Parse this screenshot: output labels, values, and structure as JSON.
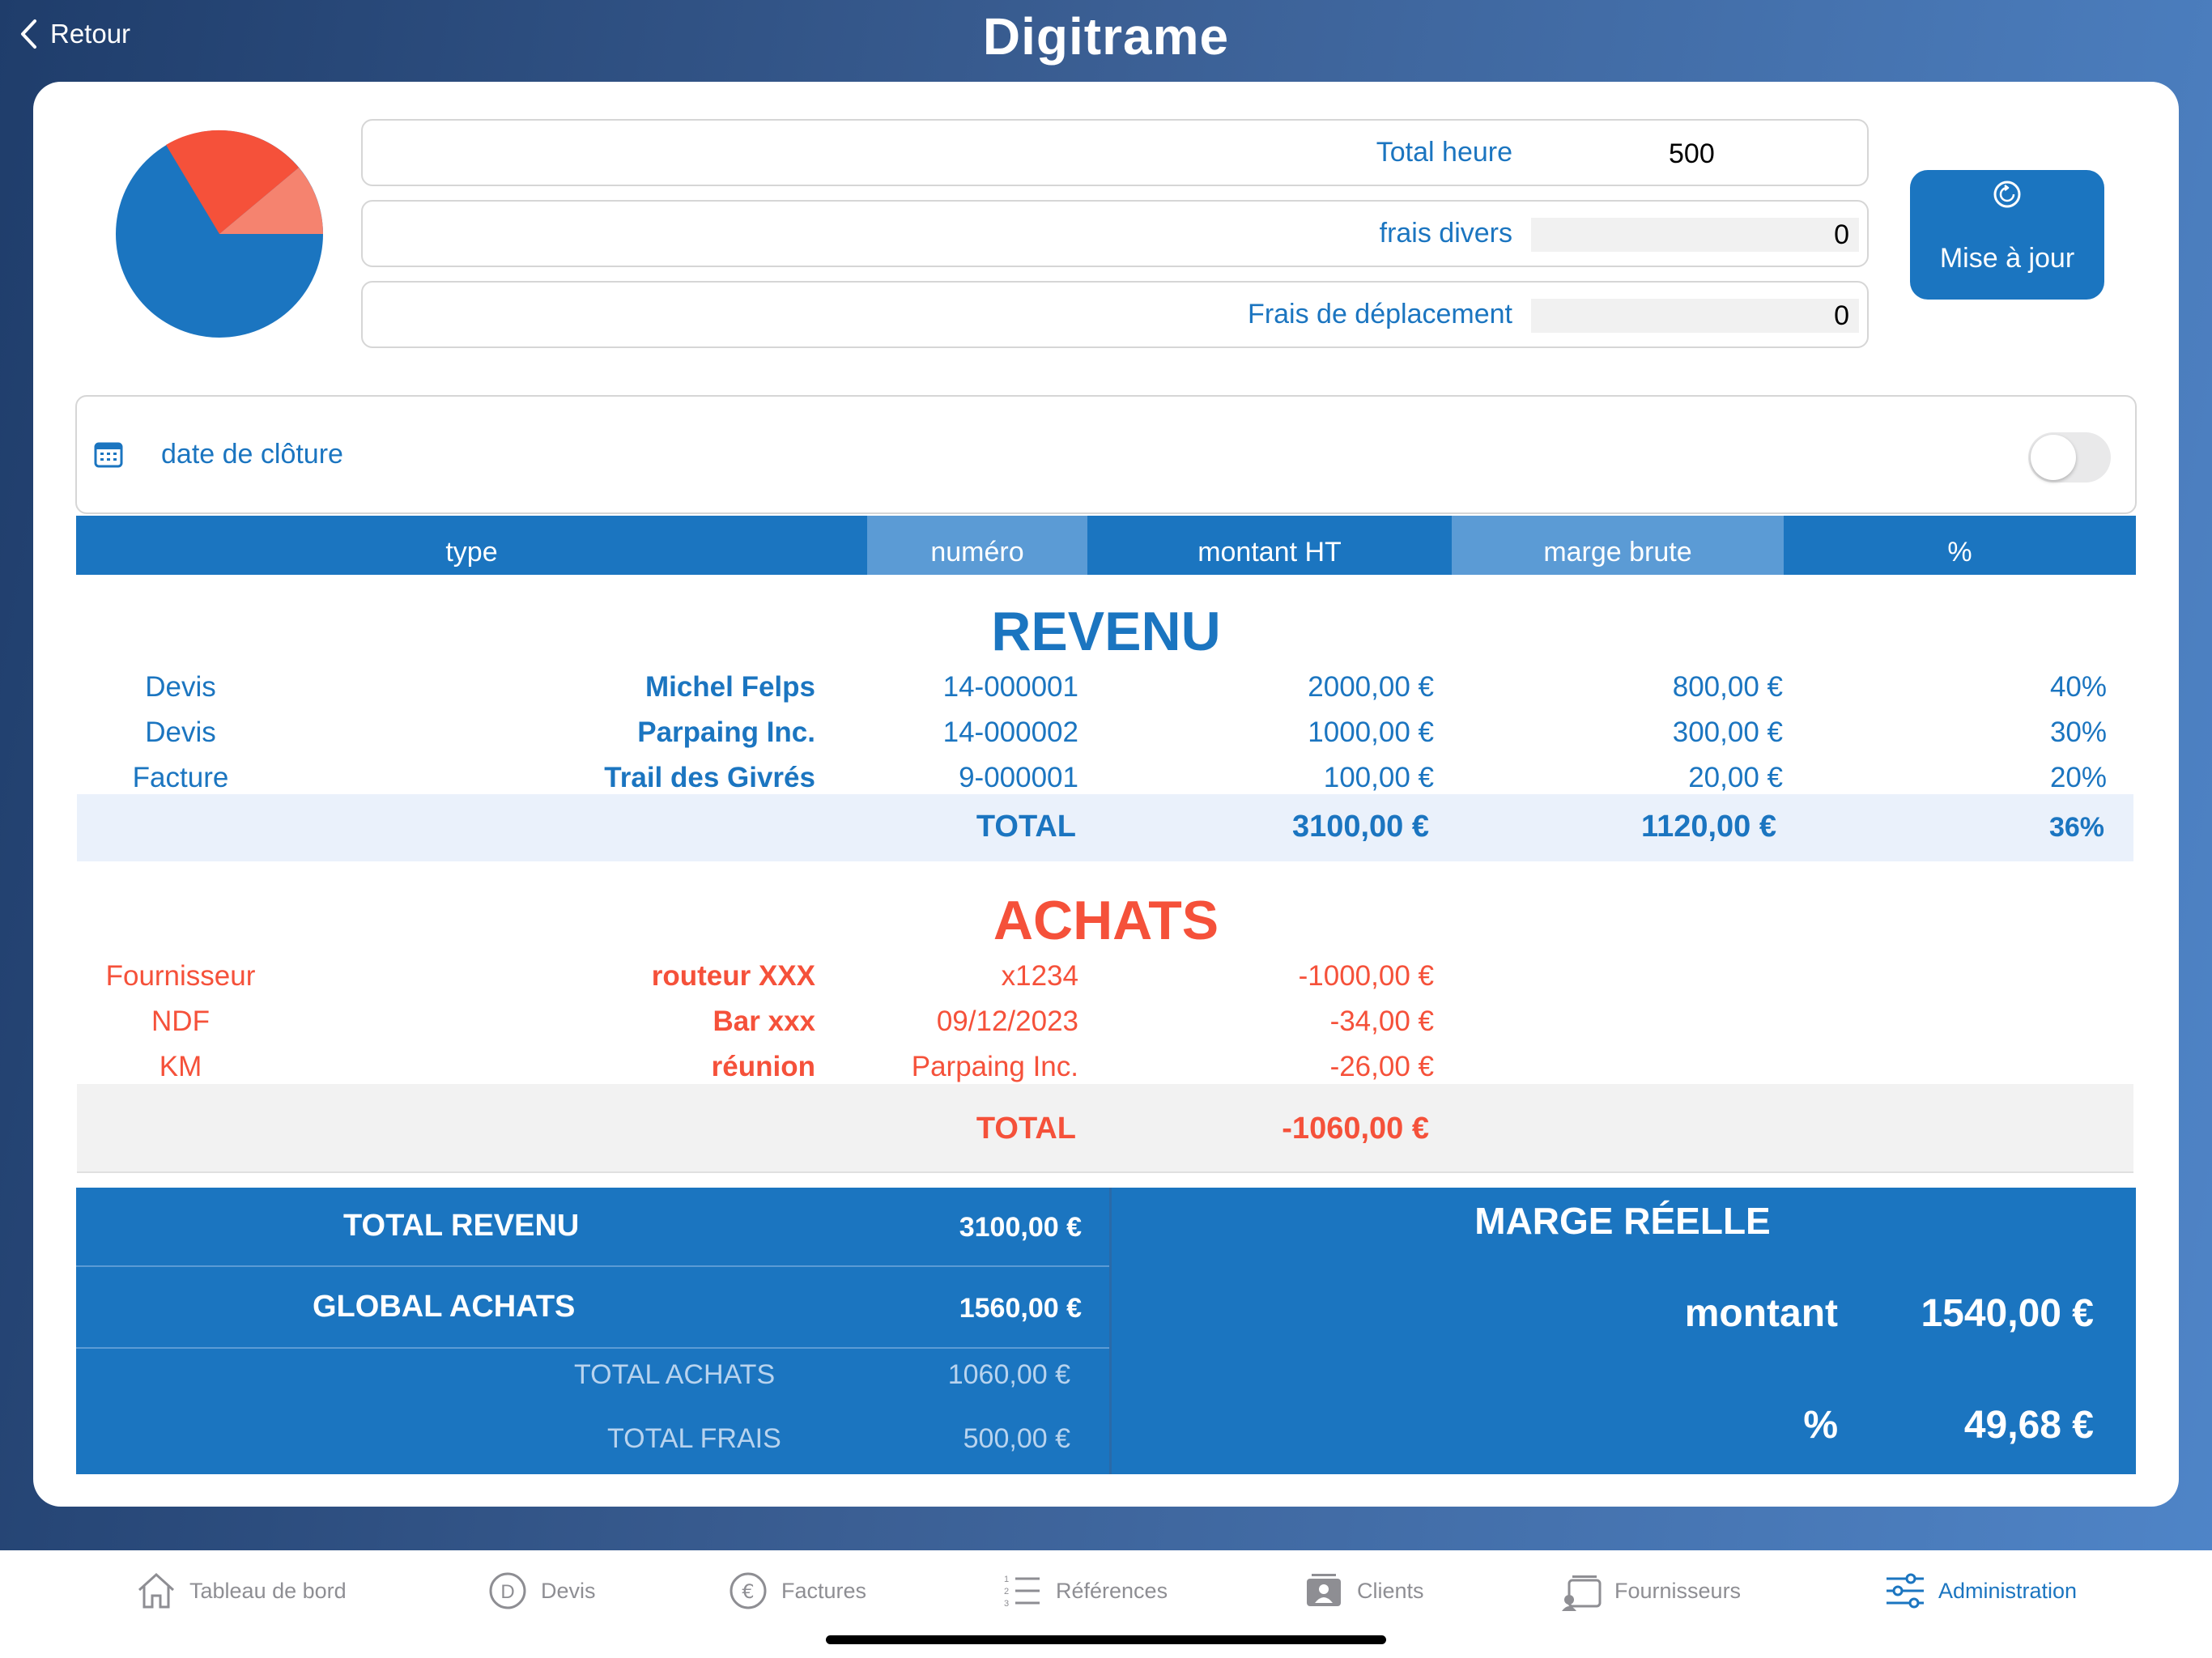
{
  "nav": {
    "back_label": "Retour",
    "app_title": "Digitrame"
  },
  "pie": {
    "colors": {
      "main": "#1b75c0",
      "red": "#f5513a",
      "light_red": "#f5836f"
    }
  },
  "fields": {
    "total_heure": {
      "label": "Total heure",
      "value": "500"
    },
    "frais_divers": {
      "label": "frais divers",
      "value": "0"
    },
    "frais_deplacement": {
      "label": "Frais de déplacement",
      "value": "0"
    }
  },
  "update_button": {
    "label": "Mise à jour",
    "icon": "refresh-icon"
  },
  "closing_date": {
    "label": "date de clôture",
    "icon": "calendar-icon",
    "toggle_on": false
  },
  "table_header": {
    "type": "type",
    "numero": "numéro",
    "montant_ht": "montant HT",
    "marge_brute": "marge brute",
    "percent": "%"
  },
  "revenu": {
    "title": "REVENU",
    "rows": [
      {
        "type": "Devis",
        "name": "Michel Felps",
        "numero": "14-000001",
        "montant": "2000,00 €",
        "marge": "800,00 €",
        "percent": "40%"
      },
      {
        "type": "Devis",
        "name": "Parpaing Inc.",
        "numero": "14-000002",
        "montant": "1000,00 €",
        "marge": "300,00 €",
        "percent": "30%"
      },
      {
        "type": "Facture",
        "name": "Trail des Givrés",
        "numero": "9-000001",
        "montant": "100,00 €",
        "marge": "20,00 €",
        "percent": "20%"
      }
    ],
    "total": {
      "label": "TOTAL",
      "montant": "3100,00 €",
      "marge": "1120,00 €",
      "percent": "36%"
    }
  },
  "achats": {
    "title": "ACHATS",
    "rows": [
      {
        "type": "Fournisseur",
        "name": "routeur XXX",
        "numero": "x1234",
        "montant": "-1000,00 €"
      },
      {
        "type": "NDF",
        "name": "Bar xxx",
        "numero": "09/12/2023",
        "montant": "-34,00 €"
      },
      {
        "type": "KM",
        "name": "réunion",
        "numero": "Parpaing Inc.",
        "montant": "-26,00 €"
      }
    ],
    "total": {
      "label": "TOTAL",
      "montant": "-1060,00 €"
    }
  },
  "summary": {
    "total_revenu": {
      "label": "TOTAL REVENU",
      "value": "3100,00 €"
    },
    "global_achats": {
      "label": "GLOBAL ACHATS",
      "value": "1560,00 €"
    },
    "total_achats": {
      "label": "TOTAL ACHATS",
      "value": "1060,00 €"
    },
    "total_frais": {
      "label": "TOTAL FRAIS",
      "value": "500,00 €"
    },
    "marge_reelle": {
      "title": "MARGE RÉELLE",
      "montant_label": "montant",
      "montant_value": "1540,00 €",
      "percent_label": "%",
      "percent_value": "49,68 €"
    }
  },
  "tabbar": {
    "items": [
      {
        "label": "Tableau de bord",
        "icon": "home-icon",
        "active": false
      },
      {
        "label": "Devis",
        "icon": "devis-icon",
        "active": false
      },
      {
        "label": "Factures",
        "icon": "euro-icon",
        "active": false
      },
      {
        "label": "Références",
        "icon": "list-icon",
        "active": false
      },
      {
        "label": "Clients",
        "icon": "clients-icon",
        "active": false
      },
      {
        "label": "Fournisseurs",
        "icon": "suppliers-icon",
        "active": false
      },
      {
        "label": "Administration",
        "icon": "sliders-icon",
        "active": true
      }
    ]
  }
}
